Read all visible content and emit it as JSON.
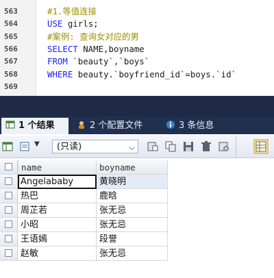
{
  "editor": {
    "lines": [
      {
        "num": "563",
        "tokens": [
          {
            "t": "#1.等值连接",
            "k": "comment"
          }
        ]
      },
      {
        "num": "564",
        "tokens": [
          {
            "t": "USE",
            "k": "kw"
          },
          {
            "t": " girls;",
            "k": "plain"
          }
        ]
      },
      {
        "num": "565",
        "tokens": [
          {
            "t": "#案例: 查询女对应的男",
            "k": "comment"
          }
        ]
      },
      {
        "num": "566",
        "tokens": [
          {
            "t": "SELECT",
            "k": "kw"
          },
          {
            "t": " NAME,boyname",
            "k": "plain"
          }
        ]
      },
      {
        "num": "567",
        "tokens": [
          {
            "t": "FROM",
            "k": "kw"
          },
          {
            "t": " `beauty`,`boys`",
            "k": "plain"
          }
        ]
      },
      {
        "num": "568",
        "tokens": [
          {
            "t": "WHERE",
            "k": "kw"
          },
          {
            "t": " beauty.`boyfriend_id`=boys.`id`",
            "k": "plain"
          }
        ]
      },
      {
        "num": "569",
        "tokens": []
      }
    ]
  },
  "tabs": [
    {
      "label": "1 个结果",
      "icon": "table-icon",
      "active": true
    },
    {
      "label": "2 个配置文件",
      "icon": "profile-icon",
      "active": false
    },
    {
      "label": "3 条信息",
      "icon": "info-icon",
      "active": false
    }
  ],
  "toolbar": {
    "mode_value": "(只读)"
  },
  "grid": {
    "columns": [
      "name",
      "boyname"
    ],
    "rows": [
      [
        "Angelababy",
        "黄晓明"
      ],
      [
        "热巴",
        "鹿晗"
      ],
      [
        "周芷若",
        "张无忌"
      ],
      [
        "小昭",
        "张无忌"
      ],
      [
        "王语嫣",
        "段誉"
      ],
      [
        "赵敏",
        "张无忌"
      ]
    ]
  },
  "colors": {
    "keyword": "#1e1ef0",
    "comment": "#9a8f00",
    "tab_bar": "#22304f"
  }
}
